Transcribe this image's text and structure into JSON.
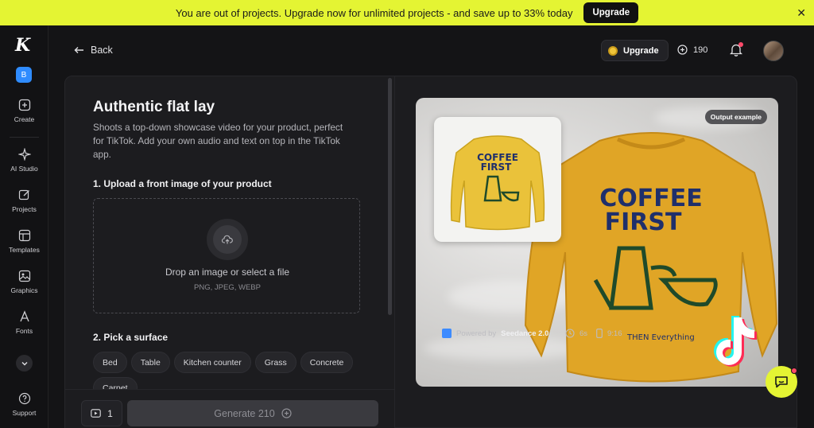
{
  "banner": {
    "text": "You are out of projects. Upgrade now for unlimited projects - and save up to 33% today",
    "button": "Upgrade",
    "close_icon": "close-icon"
  },
  "sidebar": {
    "logo": "K",
    "workspace_badge": "B",
    "items": [
      {
        "label": "Create",
        "icon": "plus-square-icon"
      },
      {
        "label": "AI Studio",
        "icon": "sparkle-icon"
      },
      {
        "label": "Projects",
        "icon": "edit-icon"
      },
      {
        "label": "Templates",
        "icon": "template-icon"
      },
      {
        "label": "Graphics",
        "icon": "image-icon"
      },
      {
        "label": "Fonts",
        "icon": "font-icon"
      },
      {
        "label": "Support",
        "icon": "help-icon"
      }
    ]
  },
  "topbar": {
    "back_label": "Back",
    "upgrade_label": "Upgrade",
    "credits": "190"
  },
  "form": {
    "title": "Authentic flat lay",
    "description": "Shoots a top-down showcase video for your product, perfect for TikTok. Add your own audio and text on top in the TikTok app.",
    "step1_label": "1. Upload a front image of your product",
    "dropzone_text": "Drop an image or select a file",
    "dropzone_formats": "PNG, JPEG, WEBP",
    "step2_label": "2. Pick a surface",
    "surfaces": [
      "Bed",
      "Table",
      "Kitchen counter",
      "Grass",
      "Concrete",
      "Carpet"
    ],
    "video_count": "1",
    "generate_label": "Generate 210"
  },
  "preview": {
    "badge": "Output example",
    "sweater_text_line1": "COFFEE",
    "sweater_text_line2": "FIRST",
    "sweater_text_small": "THEN Everything",
    "powered_by_prefix": "Powered by",
    "powered_by_model": "Seedance 2.0",
    "duration": "6s",
    "aspect_ratio": "9:16"
  },
  "colors": {
    "banner_bg": "#e4f433",
    "sweater": "#e0a526",
    "accent_blue": "#2f8cff"
  }
}
